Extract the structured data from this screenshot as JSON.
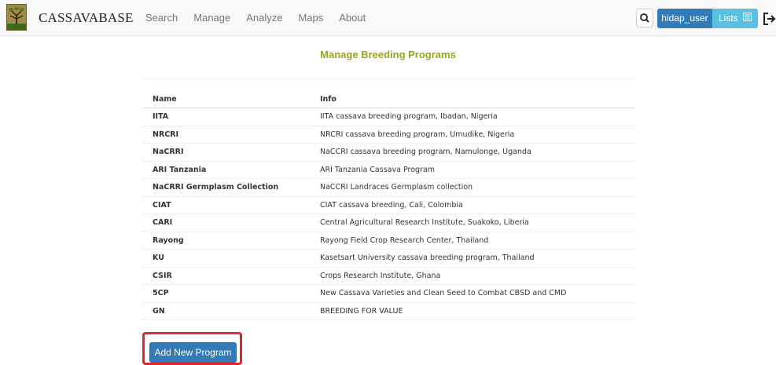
{
  "navbar": {
    "brand": "CASSAVABASE",
    "links": [
      {
        "label": "Search"
      },
      {
        "label": "Manage"
      },
      {
        "label": "Analyze"
      },
      {
        "label": "Maps"
      },
      {
        "label": "About"
      }
    ],
    "user_label": "hidap_user",
    "lists_label": "Lists",
    "icons": [
      "search-icon",
      "list-icon",
      "logout-icon"
    ]
  },
  "page": {
    "title": "Manage Breeding Programs"
  },
  "table": {
    "headers": [
      "Name",
      "Info"
    ],
    "rows": [
      {
        "name": "IITA",
        "info": "IITA cassava breeding program, Ibadan, Nigeria"
      },
      {
        "name": "NRCRI",
        "info": "NRCRI cassava breeding program, Umudike, Nigeria"
      },
      {
        "name": "NaCRRI",
        "info": "NaCCRI cassava breeding program, Namulonge, Uganda"
      },
      {
        "name": "ARI Tanzania",
        "info": "ARI Tanzania Cassava Program"
      },
      {
        "name": "NaCRRI Germplasm Collection",
        "info": "NaCCRI Landraces Germplasm collection"
      },
      {
        "name": "CIAT",
        "info": "CIAT cassava breeding, Cali, Colombia"
      },
      {
        "name": "CARI",
        "info": "Central Agricultural Research Institute, Suakoko, Liberia"
      },
      {
        "name": "Rayong",
        "info": "Rayong Field Crop Research Center, Thailand"
      },
      {
        "name": "KU",
        "info": "Kasetsart University cassava breeding program, Thailand"
      },
      {
        "name": "CSIR",
        "info": "Crops Research Institute, Ghana"
      },
      {
        "name": "5CP",
        "info": "New Cassava Varieties and Clean Seed to Combat CBSD and CMD"
      },
      {
        "name": "GN",
        "info": "BREEDING FOR VALUE"
      }
    ]
  },
  "actions": {
    "add_label": "Add New Program"
  },
  "colors": {
    "title": "#99a31c",
    "primary": "#337ab7",
    "info": "#5bc0de",
    "highlight": "#e8232a"
  }
}
